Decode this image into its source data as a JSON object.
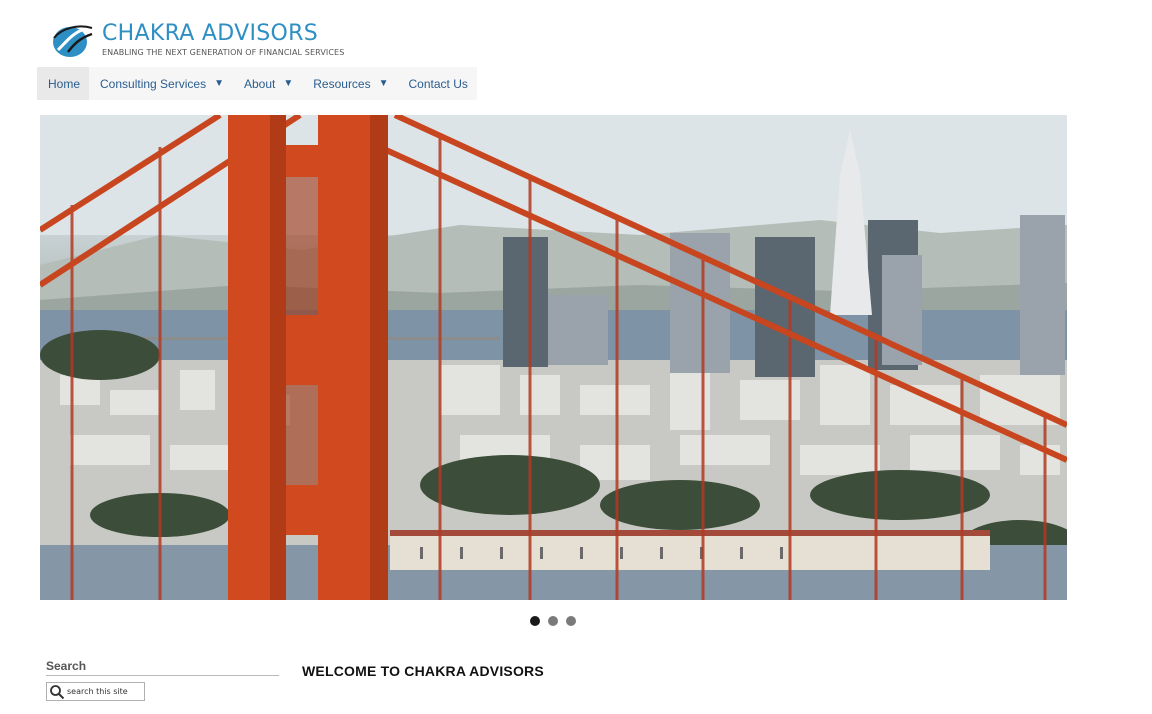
{
  "brand": {
    "name": "CHAKRA ADVISORS",
    "tagline": "ENABLING THE NEXT GENERATION OF FINANCIAL SERVICES",
    "color": "#2e8fc4"
  },
  "nav": {
    "items": [
      {
        "label": "Home",
        "active": true,
        "has_dropdown": false
      },
      {
        "label": "Consulting Services",
        "active": false,
        "has_dropdown": true
      },
      {
        "label": "About",
        "active": false,
        "has_dropdown": true
      },
      {
        "label": "Resources",
        "active": false,
        "has_dropdown": true
      },
      {
        "label": "Contact Us",
        "active": false,
        "has_dropdown": false
      }
    ],
    "dropdown_glyph": "▼"
  },
  "hero": {
    "description_icon": "golden-gate-bridge-san-francisco-skyline",
    "slides_total": 3,
    "active_slide": 1
  },
  "sidebar": {
    "search_title": "Search",
    "search_placeholder": "search this site"
  },
  "main": {
    "welcome_heading": "WELCOME TO CHAKRA ADVISORS"
  },
  "colors": {
    "nav_text": "#2a5d8f",
    "bridge_orange": "#c8461f"
  }
}
